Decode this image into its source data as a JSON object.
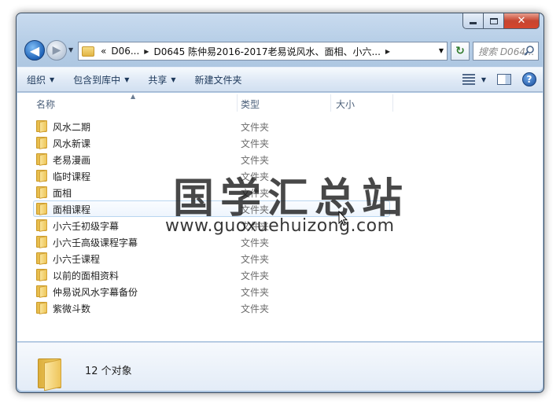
{
  "window": {
    "close_glyph": "✕"
  },
  "nav": {
    "back_glyph": "◀",
    "forward_glyph": "▶",
    "breadcrumbs": {
      "overflow": "«",
      "crumb1": "D06...",
      "crumb2": "D0645 陈仲易2016-2017老易说风水、面相、小六...",
      "sep": "▶"
    },
    "refresh_glyph": "↻",
    "search_placeholder": "搜索 D064...",
    "icons": [
      "back-arrow-icon",
      "forward-arrow-icon",
      "folder-icon",
      "refresh-icon",
      "search-icon"
    ]
  },
  "toolbar": {
    "organize": "组织",
    "include_library": "包含到库中",
    "share": "共享",
    "new_folder": "新建文件夹",
    "caret": "▼",
    "help_glyph": "?",
    "icons": [
      "view-options-icon",
      "preview-pane-icon",
      "help-icon"
    ]
  },
  "columns": {
    "name": "名称",
    "type": "类型",
    "size": "大小",
    "sort_glyph": "▲"
  },
  "files": [
    {
      "name": "风水二期",
      "type": "文件夹"
    },
    {
      "name": "风水新课",
      "type": "文件夹"
    },
    {
      "name": "老易漫画",
      "type": "文件夹"
    },
    {
      "name": "临时课程",
      "type": "文件夹"
    },
    {
      "name": "面相",
      "type": "文件夹"
    },
    {
      "name": "面相课程",
      "type": "文件夹"
    },
    {
      "name": "小六壬初级字幕",
      "type": "文件夹"
    },
    {
      "name": "小六壬高级课程字幕",
      "type": "文件夹"
    },
    {
      "name": "小六壬课程",
      "type": "文件夹"
    },
    {
      "name": "以前的面相资料",
      "type": "文件夹"
    },
    {
      "name": "仲易说风水字幕备份",
      "type": "文件夹"
    },
    {
      "name": "紫微斗数",
      "type": "文件夹"
    }
  ],
  "hovered_row": 5,
  "watermark": {
    "title": "国学汇总站",
    "url": "www.guoxuehuizong.com"
  },
  "details": {
    "count": "12 个对象"
  },
  "colors": {
    "frame": "#b5cde6",
    "toolbar_text": "#1e395b",
    "hover_border": "#b8d6f0",
    "folder_yellow": "#f3d46c"
  }
}
